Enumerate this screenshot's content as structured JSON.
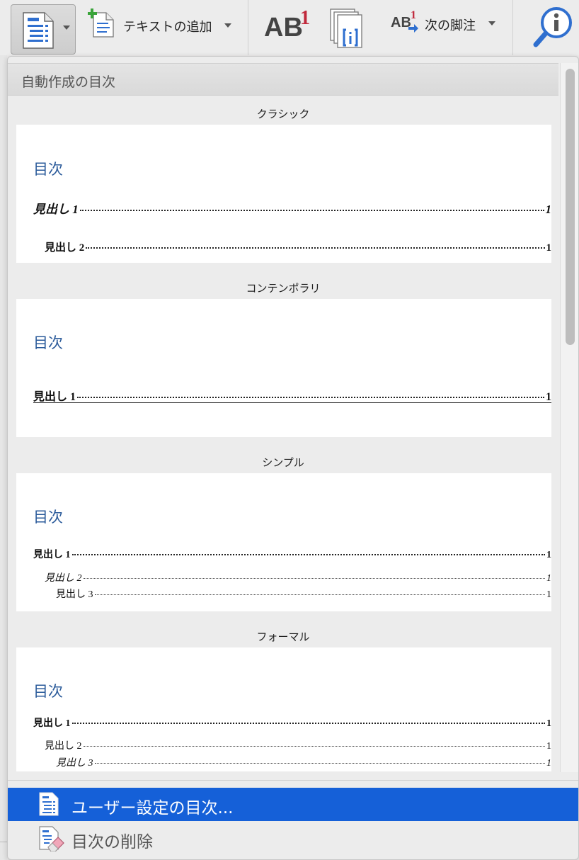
{
  "ribbon": {
    "toc_button": {
      "icon": "table-of-contents-icon"
    },
    "add_text": {
      "label": "テキストの追加",
      "icon": "add-text-icon"
    },
    "insert_footnote": {
      "ab": "AB",
      "sup": "1",
      "icon": "insert-footnote-icon"
    },
    "insert_endnote": {
      "icon": "insert-endnote-icon"
    },
    "next_footnote": {
      "ab": "AB",
      "sup": "1",
      "label": "次の脚注",
      "icon": "next-footnote-icon"
    },
    "smart_lookup": {
      "icon": "smart-lookup-icon"
    }
  },
  "panel": {
    "header": "自動作成の目次",
    "sections": [
      {
        "name": "クラシック",
        "toc_title": "目次",
        "entries": [
          {
            "text": "見出し 1",
            "page": "1"
          },
          {
            "text": "見出し 2",
            "page": "1"
          }
        ]
      },
      {
        "name": "コンテンポラリ",
        "toc_title": "目次",
        "entries": [
          {
            "text": "見出し 1",
            "page": "1"
          }
        ]
      },
      {
        "name": "シンプル",
        "toc_title": "目次",
        "entries": [
          {
            "text": "見出し 1",
            "page": "1"
          },
          {
            "text": "見出し 2",
            "page": "1"
          },
          {
            "text": "見出し 3",
            "page": "1"
          }
        ]
      },
      {
        "name": "フォーマル",
        "toc_title": "目次",
        "entries": [
          {
            "text": "見出し 1",
            "page": "1"
          },
          {
            "text": "見出し 2",
            "page": "1"
          },
          {
            "text": "見出し 3",
            "page": "1"
          }
        ]
      }
    ],
    "menu": [
      {
        "label": "ユーザー設定の目次...",
        "icon": "custom-toc-icon",
        "selected": true
      },
      {
        "label": "目次の削除",
        "icon": "remove-toc-icon",
        "selected": false
      }
    ]
  },
  "colors": {
    "accent": "#1560d8",
    "toc_title": "#2a5a9a",
    "superscript": "#c0283b"
  }
}
